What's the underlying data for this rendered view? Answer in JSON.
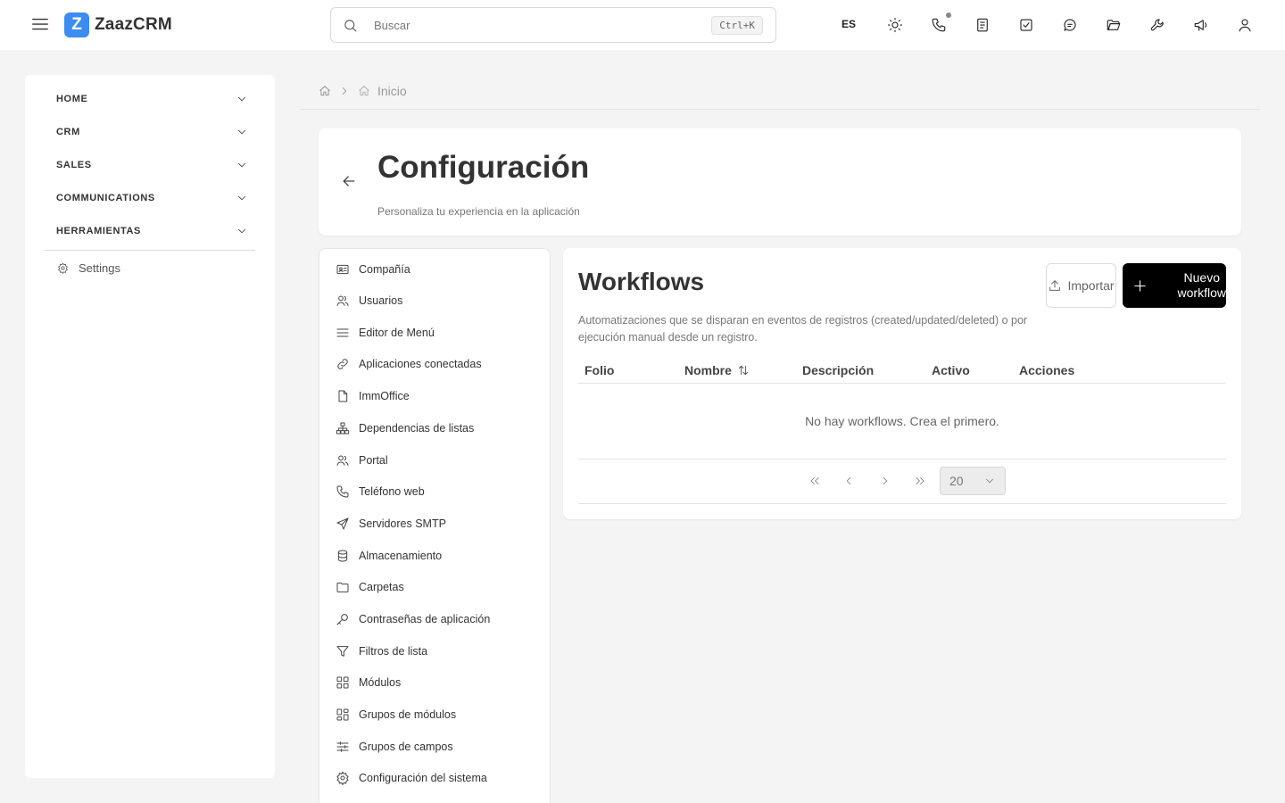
{
  "app": {
    "logo_letter": "Z",
    "name": "ZaazCRM",
    "brand_color": "#3d8cf0"
  },
  "search": {
    "placeholder": "Buscar",
    "shortcut": "Ctrl+K"
  },
  "topbar": {
    "language": "ES",
    "icons": [
      "sun-icon",
      "phone-icon",
      "notes-icon",
      "tasks-icon",
      "chat-icon",
      "folder-open-icon",
      "wrench-icon",
      "megaphone-icon",
      "user-icon"
    ]
  },
  "sidebar": {
    "items": [
      {
        "label": "HOME"
      },
      {
        "label": "CRM"
      },
      {
        "label": "SALES"
      },
      {
        "label": "COMMUNICATIONS"
      },
      {
        "label": "HERRAMIENTAS"
      }
    ],
    "settings_label": "Settings"
  },
  "breadcrumb": {
    "current": "Inicio"
  },
  "header": {
    "title": "Configuración",
    "subtitle": "Personaliza tu experiencia en la aplicación"
  },
  "settings_menu": {
    "items": [
      {
        "label": "Compañía",
        "icon": "id-card-icon"
      },
      {
        "label": "Usuarios",
        "icon": "users-icon"
      },
      {
        "label": "Editor de Menú",
        "icon": "menu-lines-icon"
      },
      {
        "label": "Aplicaciones conectadas",
        "icon": "link-icon"
      },
      {
        "label": "ImmOffice",
        "icon": "file-icon"
      },
      {
        "label": "Dependencias de listas",
        "icon": "hierarchy-icon"
      },
      {
        "label": "Portal",
        "icon": "users-icon"
      },
      {
        "label": "Teléfono web",
        "icon": "phone-icon"
      },
      {
        "label": "Servidores SMTP",
        "icon": "send-icon"
      },
      {
        "label": "Almacenamiento",
        "icon": "database-icon"
      },
      {
        "label": "Carpetas",
        "icon": "folder-icon"
      },
      {
        "label": "Contraseñas de aplicación",
        "icon": "key-icon"
      },
      {
        "label": "Filtros de lista",
        "icon": "filter-icon"
      },
      {
        "label": "Módulos",
        "icon": "grid-icon"
      },
      {
        "label": "Grupos de módulos",
        "icon": "grid-group-icon"
      },
      {
        "label": "Grupos de campos",
        "icon": "sliders-icon"
      },
      {
        "label": "Configuración del sistema",
        "icon": "gear-icon"
      }
    ]
  },
  "workflows": {
    "title": "Workflows",
    "description": "Automatizaciones que se disparan en eventos de registros (created/updated/deleted) o por ejecución manual desde un registro.",
    "import_label": "Importar",
    "new_label": "Nuevo workflow",
    "columns": [
      "Folio",
      "Nombre",
      "Descripción",
      "Activo",
      "Acciones"
    ],
    "empty_message": "No hay workflows. Crea el primero.",
    "page_size": "20"
  }
}
